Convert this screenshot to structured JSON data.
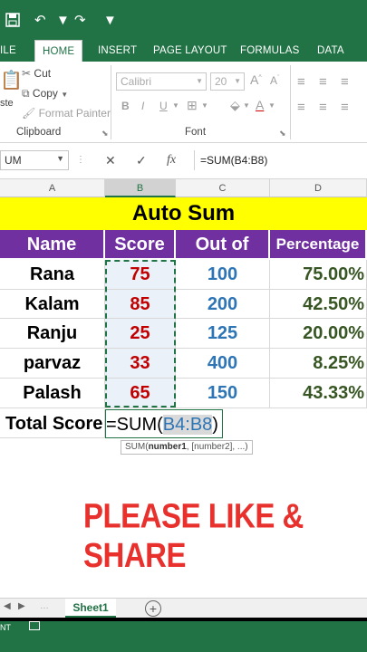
{
  "app": {
    "accent": "#217346"
  },
  "ribbon_tabs": {
    "file": "ILE",
    "home": "HOME",
    "insert": "INSERT",
    "page_layout": "PAGE LAYOUT",
    "formulas": "FORMULAS",
    "data": "DATA"
  },
  "clipboard": {
    "cut": "Cut",
    "copy": "Copy",
    "format_painter": "Format Painter",
    "paste_partial": "ste",
    "label": "Clipboard"
  },
  "font": {
    "family": "Calibri",
    "size": "20",
    "label": "Font",
    "bold": "B",
    "italic": "I",
    "underline": "U"
  },
  "formula_bar": {
    "name_box": "UM",
    "cancel": "✕",
    "enter": "✓",
    "fx": "fx",
    "content": "=SUM(B4:B8)"
  },
  "columns": [
    "A",
    "B",
    "C",
    "D"
  ],
  "sheet": {
    "title": "Auto Sum",
    "headers": {
      "name": "Name",
      "score": "Score",
      "out_of": "Out of",
      "percentage": "Percentage"
    },
    "rows": [
      {
        "name": "Rana",
        "score": "75",
        "out_of": "100",
        "percentage": "75.00%"
      },
      {
        "name": "Kalam",
        "score": "85",
        "out_of": "200",
        "percentage": "42.50%"
      },
      {
        "name": "Ranju",
        "score": "25",
        "out_of": "125",
        "percentage": "20.00%"
      },
      {
        "name": "parvaz",
        "score": "33",
        "out_of": "400",
        "percentage": "8.25%"
      },
      {
        "name": "Palash",
        "score": "65",
        "out_of": "150",
        "percentage": "43.33%"
      }
    ],
    "total_label": "Total Score",
    "formula_prefix": "=SUM(",
    "formula_ref": "B4:B8",
    "formula_suffix": ")",
    "tooltip_fn": "SUM(",
    "tooltip_arg1": "number1",
    "tooltip_rest": ", [number2], ...)"
  },
  "promo": "PLEASE LIKE & SHARE",
  "sheet_tabs": {
    "active": "Sheet1",
    "add": "+"
  },
  "status": {
    "mode": "NT"
  }
}
